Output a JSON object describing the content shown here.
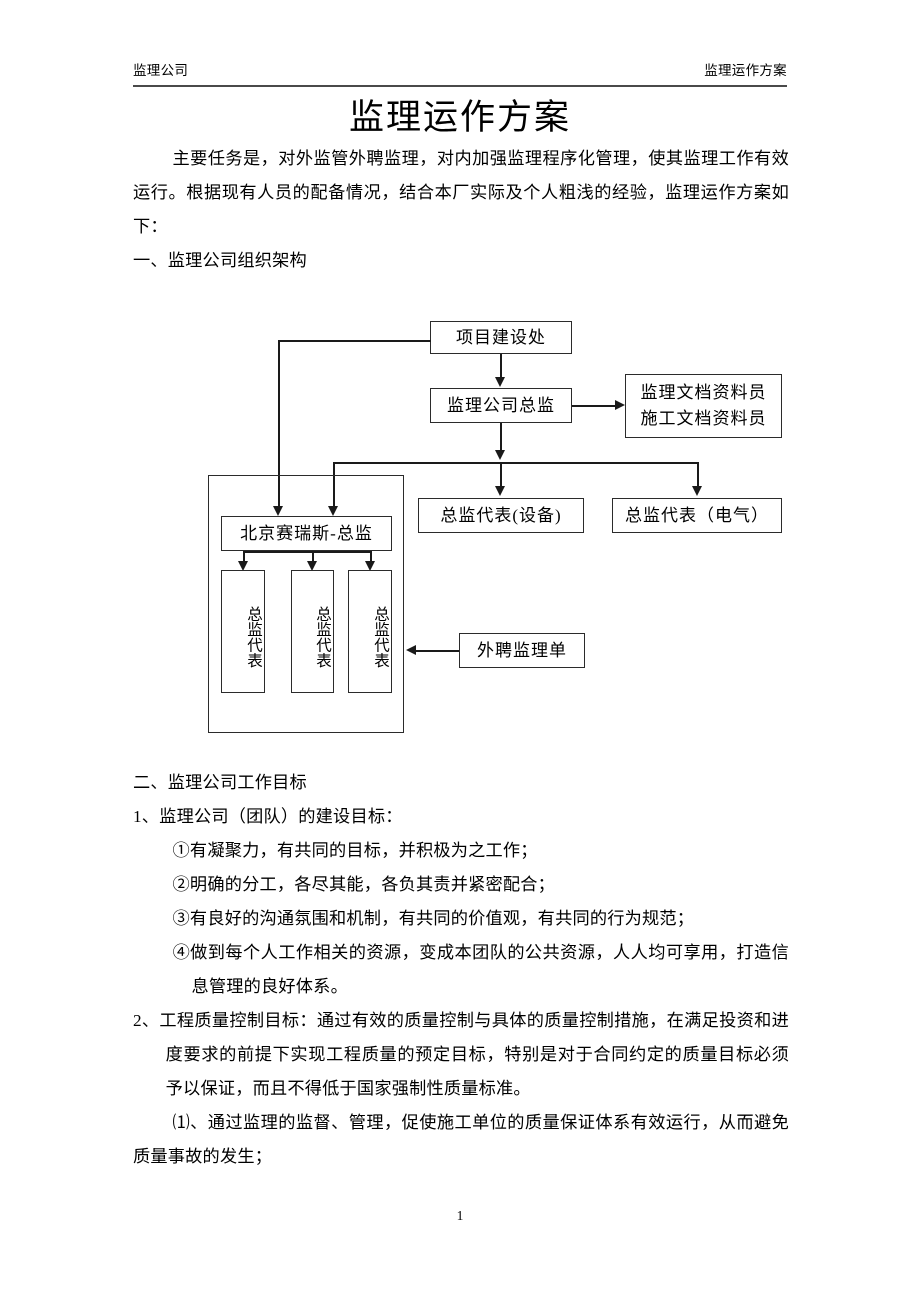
{
  "header": {
    "left": "监理公司",
    "right": "监理运作方案"
  },
  "title": "监理运作方案",
  "body": {
    "intro": "主要任务是，对外监管外聘监理，对内加强监理程序化管理，使其监理工作有效运行。根据现有人员的配备情况，结合本厂实际及个人粗浅的经验，监理运作方案如下：",
    "section_one_heading": "一、监理公司组织架构",
    "section_two_heading": "二、监理公司工作目标",
    "item_1": "1、监理公司（团队）的建设目标：",
    "item_1_a": "①有凝聚力，有共同的目标，并积极为之工作；",
    "item_1_b": "②明确的分工，各尽其能，各负其责并紧密配合；",
    "item_1_c": "③有良好的沟通氛围和机制，有共同的价值观，有共同的行为规范；",
    "item_1_d": "④做到每个人工作相关的资源，变成本团队的公共资源，人人均可享用，打造信息管理的良好体系。",
    "item_2": "2、工程质量控制目标：通过有效的质量控制与具体的质量控制措施，在满足投资和进度要求的前提下实现工程质量的预定目标，特别是对于合同约定的质量目标必须予以保证，而且不得低于国家强制性质量标准。",
    "item_2_1": "⑴、通过监理的监督、管理，促使施工单位的质量保证体系有效运行，从而避免质量事故的发生；"
  },
  "org_chart": {
    "project_construction_dept": "项目建设处",
    "chief_supervisor": "监理公司总监",
    "document_clerk_line1": "监理文档资料员",
    "document_clerk_line2": "施工文档资料员",
    "beijing_sairuisi_chief": "北京赛瑞斯-总监",
    "chief_rep_equipment": "总监代表(设备)",
    "chief_rep_electrical": "总监代表（电气）",
    "chief_rep_1": "总监代表",
    "chief_rep_2": "总监代表",
    "chief_rep_3": "总监代表",
    "external_supervision_unit": "外聘监理单"
  },
  "footer": {
    "page_number": "1"
  }
}
